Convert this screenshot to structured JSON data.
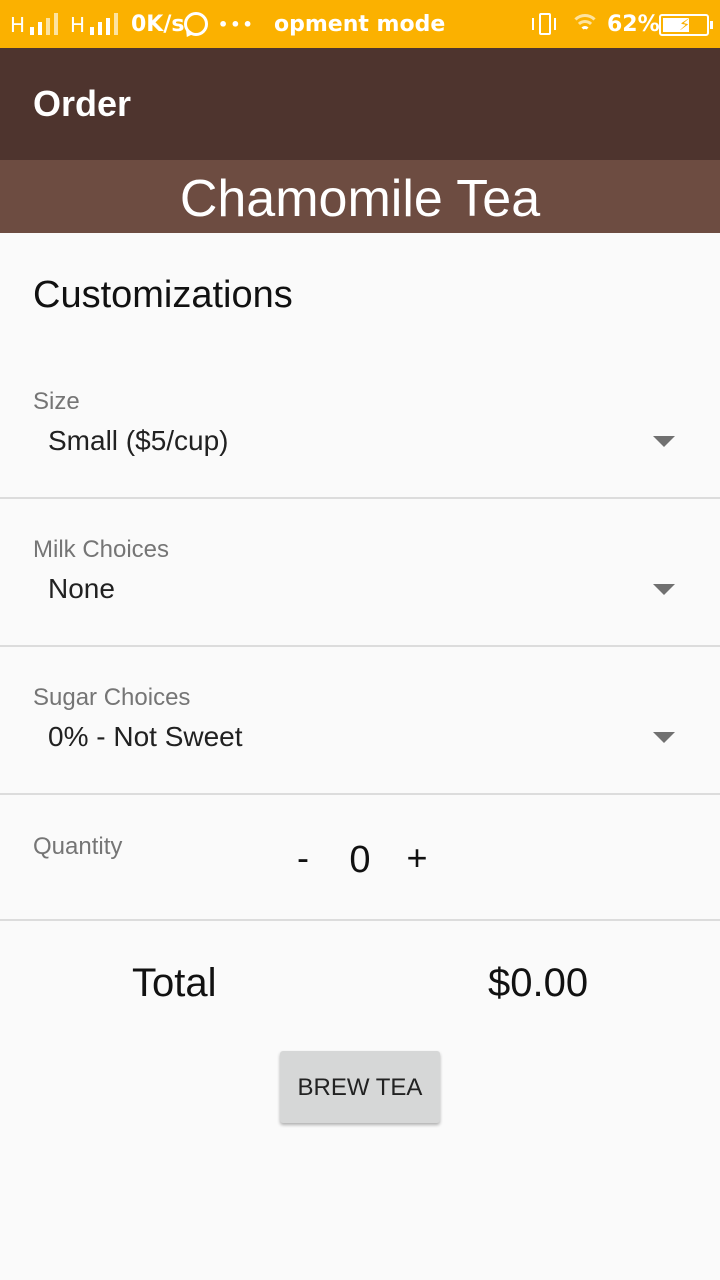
{
  "status_bar": {
    "net1": "H",
    "net2": "H",
    "speed": "0K/s",
    "dots": "•••",
    "notification": "opment mode",
    "battery_percent": "62%",
    "icons": [
      "signal-icon",
      "whatsapp-icon",
      "vibrate-icon",
      "wifi-icon",
      "battery-charging-icon"
    ],
    "battery_level": 0.62
  },
  "app_bar": {
    "title": "Order"
  },
  "banner": {
    "tea_name": "Chamomile Tea"
  },
  "customizations": {
    "title": "Customizations",
    "size": {
      "label": "Size",
      "value": "Small ($5/cup)"
    },
    "milk": {
      "label": "Milk Choices",
      "value": "None"
    },
    "sugar": {
      "label": "Sugar Choices",
      "value": "0% - Not Sweet"
    }
  },
  "quantity": {
    "label": "Quantity",
    "decrement": "-",
    "value": "0",
    "increment": "+"
  },
  "total": {
    "label": "Total",
    "value": "$0.00"
  },
  "brew_button": "BREW TEA",
  "colors": {
    "status_bar": "#fbb100",
    "app_bar": "#4e342e",
    "banner": "#6d4c41",
    "background": "#fafafa",
    "button": "#d6d7d7"
  }
}
